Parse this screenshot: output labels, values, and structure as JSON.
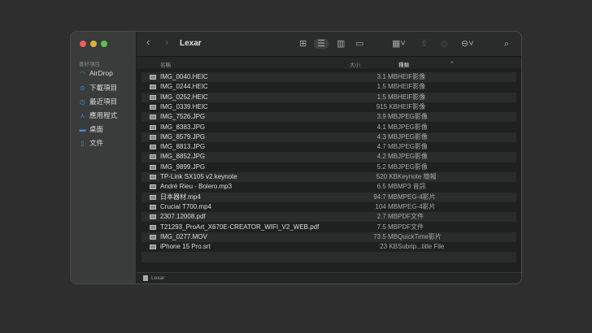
{
  "window": {
    "title": "Lexar"
  },
  "sidebar": {
    "section": "喜好項目",
    "items": [
      {
        "label": "AirDrop",
        "icon": "airdrop-icon"
      },
      {
        "label": "下載項目",
        "icon": "download-icon"
      },
      {
        "label": "最近項目",
        "icon": "clock-icon"
      },
      {
        "label": "應用程式",
        "icon": "apps-icon"
      },
      {
        "label": "桌面",
        "icon": "desktop-icon"
      },
      {
        "label": "文件",
        "icon": "document-icon"
      }
    ]
  },
  "columns": {
    "name": "名稱",
    "size": "大小",
    "kind": "種類"
  },
  "files": [
    {
      "name": "IMG_0040.HEIC",
      "size": "3.1 MB",
      "kind": "HEIF影像"
    },
    {
      "name": "IMG_0244.HEIC",
      "size": "1.5 MB",
      "kind": "HEIF影像"
    },
    {
      "name": "IMG_0252.HEIC",
      "size": "1.5 MB",
      "kind": "HEIF影像"
    },
    {
      "name": "IMG_0339.HEIC",
      "size": "915 KB",
      "kind": "HEIF影像"
    },
    {
      "name": "IMG_7526.JPG",
      "size": "3.9 MB",
      "kind": "JPEG影像"
    },
    {
      "name": "IMG_8383.JPG",
      "size": "4.1 MB",
      "kind": "JPEG影像"
    },
    {
      "name": "IMG_8579.JPG",
      "size": "4.3 MB",
      "kind": "JPEG影像"
    },
    {
      "name": "IMG_8813.JPG",
      "size": "4.7 MB",
      "kind": "JPEG影像"
    },
    {
      "name": "IMG_8852.JPG",
      "size": "4.2 MB",
      "kind": "JPEG影像"
    },
    {
      "name": "IMG_9899.JPG",
      "size": "5.2 MB",
      "kind": "JPEG影像"
    },
    {
      "name": "TP-Link SX105 v2.keynote",
      "size": "520 KB",
      "kind": "Keynote 簡報"
    },
    {
      "name": "André Rieu - Bolero.mp3",
      "size": "6.5 MB",
      "kind": "MP3 音訊"
    },
    {
      "name": "日本器材.mp4",
      "size": "94.7 MB",
      "kind": "MPEG-4影片"
    },
    {
      "name": "Crucial T700.mp4",
      "size": "104 MB",
      "kind": "MPEG-4影片"
    },
    {
      "name": "2307.12008.pdf",
      "size": "2.7 MB",
      "kind": "PDF文件"
    },
    {
      "name": "T21293_ProArt_X670E-CREATOR_WIFI_V2_WEB.pdf",
      "size": "7.5 MB",
      "kind": "PDF文件"
    },
    {
      "name": "IMG_0277.MOV",
      "size": "73.5 MB",
      "kind": "QuickTime影片"
    },
    {
      "name": "iPhone 15 Pro.srt",
      "size": "23 KB",
      "kind": "Subrip...title File"
    }
  ],
  "status": {
    "path": "Lexar"
  }
}
